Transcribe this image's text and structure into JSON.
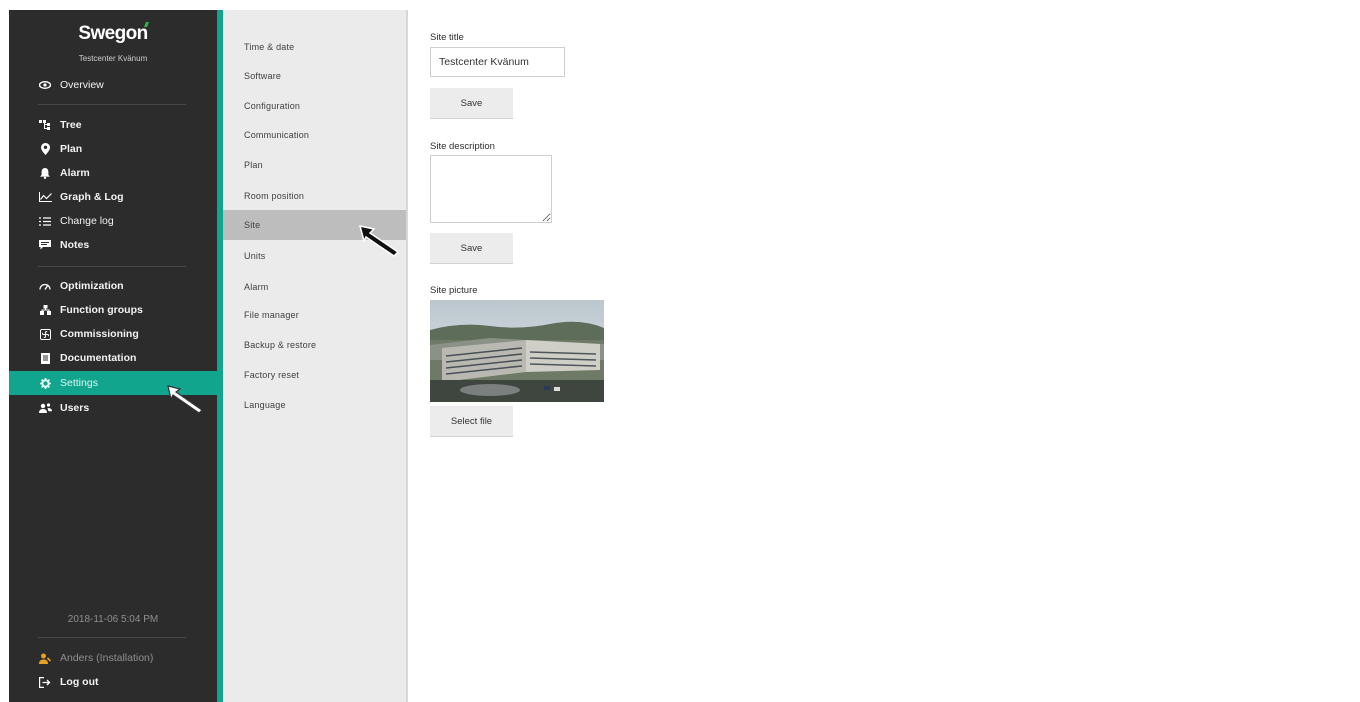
{
  "brand": {
    "logo_text": "Swegon",
    "site_name": "Testcenter Kvänum"
  },
  "sidebar": {
    "items": [
      {
        "label": "Overview",
        "icon": "eye-icon"
      },
      {
        "label": "Tree",
        "icon": "tree-icon"
      },
      {
        "label": "Plan",
        "icon": "map-pin-icon"
      },
      {
        "label": "Alarm",
        "icon": "bell-icon"
      },
      {
        "label": "Graph & Log",
        "icon": "line-graph-icon"
      },
      {
        "label": "Change log",
        "icon": "list-icon"
      },
      {
        "label": "Notes",
        "icon": "speech-bubble-icon"
      },
      {
        "label": "Optimization",
        "icon": "gauge-icon"
      },
      {
        "label": "Function groups",
        "icon": "hierarchy-icon"
      },
      {
        "label": "Commissioning",
        "icon": "fan-icon"
      },
      {
        "label": "Documentation",
        "icon": "document-icon"
      },
      {
        "label": "Settings",
        "icon": "gear-icon",
        "active": true
      },
      {
        "label": "Users",
        "icon": "users-icon"
      }
    ],
    "timestamp": "2018-11-06 5:04 PM",
    "user": {
      "label": "Anders (Installation)",
      "icon": "user-wrench-icon"
    },
    "logout": {
      "label": "Log out",
      "icon": "logout-icon"
    }
  },
  "submenu": {
    "items": [
      "Time & date",
      "Software",
      "Configuration",
      "Communication",
      "Plan",
      "Room position",
      "Site",
      "Units",
      "Alarm",
      "File manager",
      "Backup & restore",
      "Factory reset",
      "Language"
    ],
    "active": "Site"
  },
  "site": {
    "title_label": "Site title",
    "title_value": "Testcenter Kvänum",
    "title_save": "Save",
    "description_label": "Site description",
    "description_value": "",
    "description_save": "Save",
    "picture_label": "Site picture",
    "select_file": "Select file"
  },
  "colors": {
    "accent": "#12a58e",
    "sidebar_bg": "#2c2c2c",
    "submenu_bg": "#ebebeb"
  }
}
